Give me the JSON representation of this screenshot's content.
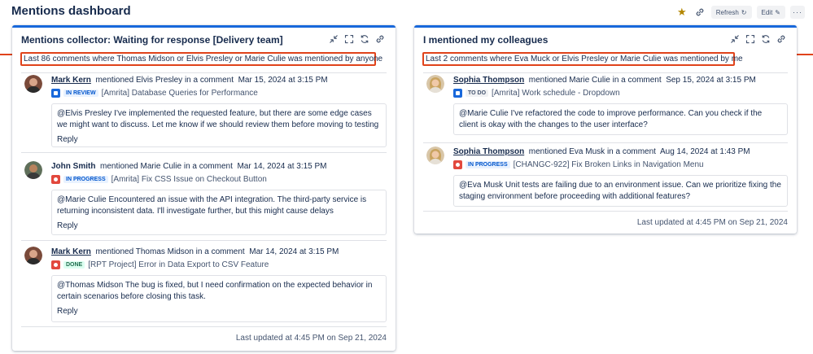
{
  "page": {
    "title": "Mentions dashboard"
  },
  "top_actions": {
    "refresh_label": "Refresh",
    "edit_label": "Edit",
    "more_label": "···"
  },
  "colors": {
    "accent": "#1868db",
    "highlight": "#e0431b",
    "in_review_bg": "#e9f2ff",
    "in_review_fg": "#0055cc",
    "in_progress_bg": "#e9f2ff",
    "in_progress_fg": "#0055cc",
    "done_bg": "#dcfff1",
    "done_fg": "#216e4e",
    "todo_bg": "#f1f2f4",
    "todo_fg": "#44546f"
  },
  "left_card": {
    "title": "Mentions collector: Waiting for response [Delivery team]",
    "subtitle": "Last 86 comments where Thomas Midson or Elvis Presley or Marie Culie was mentioned by anyone",
    "mentions": [
      {
        "author": "Mark Kern",
        "action": "mentioned Elvis Presley in a comment",
        "date": "Mar 15, 2024 at 3:15 PM",
        "status": "IN REVIEW",
        "issue": "[Amrita] Database Queries for Performance",
        "comment": "@Elvis Presley I've implemented the requested feature, but there are some edge cases we might want to discuss. Let me know if we should review them before moving to testing",
        "reply": "Reply"
      },
      {
        "author": "John Smith",
        "action": "mentioned Marie Culie in a comment",
        "date": "Mar 14, 2024 at 3:15 PM",
        "status": "IN PROGRESS",
        "issue": "[Amrita] Fix CSS Issue on Checkout Button",
        "comment": "@Marie Culie Encountered an issue with the API integration. The third-party service is returning inconsistent data. I'll investigate further, but this might cause delays",
        "reply": "Reply"
      },
      {
        "author": "Mark Kern",
        "action": "mentioned Thomas Midson in a comment",
        "date": "Mar 14, 2024 at 3:15 PM",
        "status": "DONE",
        "issue": "[RPT Project] Error in Data Export to CSV Feature",
        "comment": "@Thomas Midson The bug is fixed, but I need confirmation on the expected behavior in certain scenarios before closing this task.",
        "reply": "Reply"
      }
    ],
    "footer": "Last updated at 4:45 PM on Sep 21, 2024"
  },
  "right_card": {
    "title": "I mentioned my colleagues",
    "subtitle": "Last 2 comments where Eva Muck or Elvis Presley or Marie Culie was mentioned by me",
    "mentions": [
      {
        "author": "Sophia Thompson",
        "action": "mentioned Marie Culie in a comment",
        "date": "Sep 15, 2024 at 3:15 PM",
        "status": "TO DO",
        "issue": "[Amrita] Work schedule - Dropdown",
        "comment": "@Marie Culie I've refactored the code to improve performance. Can you check if the client is okay with the changes to the user interface?"
      },
      {
        "author": "Sophia Thompson",
        "action": "mentioned Eva Musk in a comment",
        "date": "Aug 14, 2024 at 1:43 PM",
        "status": "IN PROGRESS",
        "issue": "[CHANGC-922] Fix Broken Links in Navigation Menu",
        "comment": "@Eva Musk Unit tests are failing due to an environment issue. Can we prioritize fixing the staging environment before proceeding with additional features?"
      }
    ],
    "footer": "Last updated at 4:45 PM on Sep 21, 2024"
  }
}
